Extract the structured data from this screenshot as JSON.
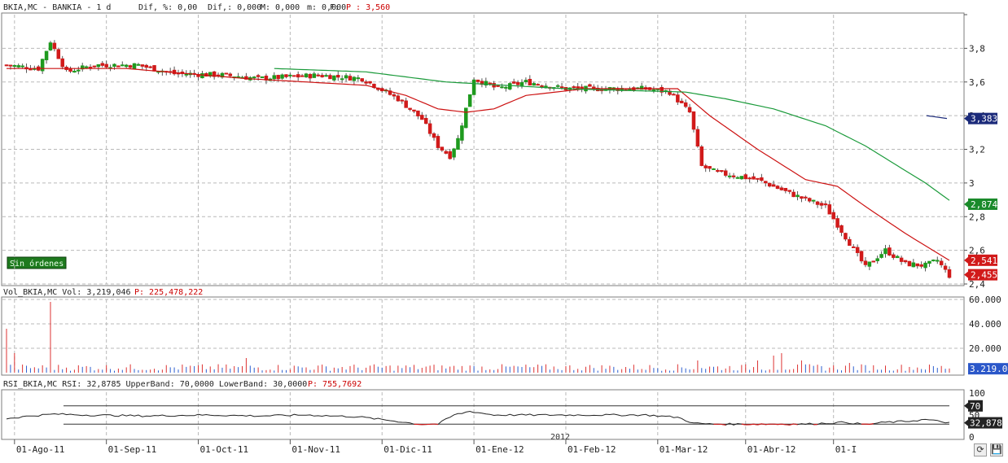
{
  "colors": {
    "up": "#1e9a1e",
    "down": "#d11a1a",
    "ma_short": "#cc1111",
    "ma_long": "#1a9a3a",
    "grid": "#b9b9b9",
    "volume_up": "#2d5fd0",
    "volume_down": "#d33",
    "rsi_line": "#222",
    "rsi_below": "#d11a1a"
  },
  "price_panel": {
    "header": {
      "symbol": "BKIA,MC - BANKIA -  1 d",
      "dif": "Dif, %: 0,00",
      "dif2": "Dif,: 0,000",
      "M": "M: 0,000",
      "m": "m: 0,000",
      "F": "F:",
      "P": "P : 3,560"
    },
    "badge": "Sin órdenes",
    "markers": [
      {
        "value": 3.383,
        "label": "3,383",
        "color": "#1b2a7a"
      },
      {
        "value": 2.874,
        "label": "2,874",
        "color": "#1a8a2a"
      },
      {
        "value": 2.541,
        "label": "2,541",
        "color": "#d11a1a"
      },
      {
        "value": 2.455,
        "label": "2,455",
        "color": "#d11a1a"
      }
    ]
  },
  "volume_panel": {
    "header": {
      "label": "Vol_BKIA,MC Vol: 3,219,046",
      "P": "P: 225,478,222"
    },
    "marker": "3.219.04"
  },
  "rsi_panel": {
    "header": {
      "label": "RSI_BKIA,MC RSI: 32,8785 UpperBand: 70,0000 LowerBand: 30,0000",
      "P": "P: 755,7692"
    },
    "markers": [
      {
        "value": 70,
        "label": "70"
      },
      {
        "value": 32.878,
        "label": "32,878"
      }
    ]
  },
  "toolbar": {
    "icon_1": "refresh-icon",
    "icon_2": "save-icon"
  },
  "chart_data": [
    {
      "type": "candlestick",
      "title": "BKIA,MC - BANKIA - 1 d",
      "ylim": [
        2.4,
        4.0
      ],
      "y_ticks": [
        "3,8",
        "3,6",
        "3,4",
        "3,2",
        "3",
        "2,8",
        "2,6",
        "2,4"
      ],
      "y_tick_values": [
        3.8,
        3.6,
        3.4,
        3.2,
        3.0,
        2.8,
        2.6,
        2.4
      ],
      "x_tick_labels": [
        "01-Ago-11",
        "01-Sep-11",
        "01-Oct-11",
        "01-Nov-11",
        "01-Dic-11",
        "01-Ene-12",
        "01-Feb-12",
        "01-Mar-12",
        "01-Abr-12",
        "01-I"
      ],
      "year_label": "2012",
      "close_anchors": [
        [
          0,
          3.7
        ],
        [
          8,
          3.68
        ],
        [
          11,
          3.84
        ],
        [
          15,
          3.66
        ],
        [
          22,
          3.7
        ],
        [
          33,
          3.7
        ],
        [
          42,
          3.65
        ],
        [
          55,
          3.64
        ],
        [
          63,
          3.62
        ],
        [
          78,
          3.64
        ],
        [
          89,
          3.62
        ],
        [
          98,
          3.5
        ],
        [
          104,
          3.38
        ],
        [
          108,
          3.22
        ],
        [
          111,
          3.16
        ],
        [
          113,
          3.26
        ],
        [
          115,
          3.44
        ],
        [
          117,
          3.62
        ],
        [
          123,
          3.56
        ],
        [
          130,
          3.6
        ],
        [
          140,
          3.56
        ],
        [
          150,
          3.56
        ],
        [
          160,
          3.56
        ],
        [
          166,
          3.54
        ],
        [
          171,
          3.42
        ],
        [
          174,
          3.1
        ],
        [
          178,
          3.06
        ],
        [
          188,
          3.02
        ],
        [
          194,
          2.96
        ],
        [
          198,
          2.92
        ],
        [
          205,
          2.86
        ],
        [
          210,
          2.68
        ],
        [
          215,
          2.5
        ],
        [
          220,
          2.6
        ],
        [
          225,
          2.52
        ],
        [
          230,
          2.51
        ],
        [
          233,
          2.54
        ],
        [
          236,
          2.45
        ]
      ],
      "ma_short_anchors": [
        [
          0,
          3.68
        ],
        [
          30,
          3.68
        ],
        [
          60,
          3.62
        ],
        [
          90,
          3.58
        ],
        [
          100,
          3.52
        ],
        [
          108,
          3.44
        ],
        [
          115,
          3.42
        ],
        [
          122,
          3.44
        ],
        [
          130,
          3.52
        ],
        [
          145,
          3.56
        ],
        [
          168,
          3.56
        ],
        [
          176,
          3.4
        ],
        [
          188,
          3.2
        ],
        [
          200,
          3.02
        ],
        [
          208,
          2.98
        ],
        [
          215,
          2.86
        ],
        [
          225,
          2.7
        ],
        [
          236,
          2.54
        ]
      ],
      "ma_long_anchors": [
        [
          67,
          3.68
        ],
        [
          90,
          3.66
        ],
        [
          110,
          3.6
        ],
        [
          140,
          3.56
        ],
        [
          170,
          3.54
        ],
        [
          180,
          3.5
        ],
        [
          192,
          3.44
        ],
        [
          205,
          3.34
        ],
        [
          215,
          3.22
        ],
        [
          230,
          3.0
        ],
        [
          237,
          2.88
        ]
      ]
    },
    {
      "type": "bar",
      "title": "Vol_BKIA,MC",
      "ylim": [
        0,
        60000000
      ],
      "y_ticks": [
        "60.000",
        "40.000",
        "20.000"
      ],
      "y_tick_values": [
        60000000,
        40000000,
        20000000
      ],
      "spikes": [
        [
          0,
          36000000
        ],
        [
          2,
          16000000
        ],
        [
          11,
          58000000
        ],
        [
          60,
          12000000
        ],
        [
          173,
          10000000
        ],
        [
          188,
          10000000
        ],
        [
          192,
          14000000
        ],
        [
          194,
          16000000
        ],
        [
          199,
          10000000
        ],
        [
          211,
          8000000
        ]
      ]
    },
    {
      "type": "line",
      "title": "RSI_BKIA,MC",
      "ylim": [
        0,
        100
      ],
      "y_ticks": [
        "100",
        "50",
        "0"
      ],
      "y_tick_values": [
        100,
        50,
        0
      ],
      "bands": [
        70,
        30
      ],
      "anchors": [
        [
          0,
          42
        ],
        [
          6,
          48
        ],
        [
          12,
          52
        ],
        [
          20,
          50
        ],
        [
          35,
          48
        ],
        [
          50,
          50
        ],
        [
          63,
          48
        ],
        [
          75,
          50
        ],
        [
          88,
          46
        ],
        [
          98,
          36
        ],
        [
          103,
          30
        ],
        [
          108,
          30
        ],
        [
          112,
          50
        ],
        [
          116,
          58
        ],
        [
          122,
          50
        ],
        [
          140,
          50
        ],
        [
          160,
          50
        ],
        [
          168,
          45
        ],
        [
          172,
          32
        ],
        [
          176,
          30
        ],
        [
          200,
          30
        ],
        [
          210,
          34
        ],
        [
          215,
          29
        ],
        [
          220,
          34
        ],
        [
          225,
          36
        ],
        [
          230,
          40
        ],
        [
          236,
          33
        ]
      ]
    }
  ]
}
